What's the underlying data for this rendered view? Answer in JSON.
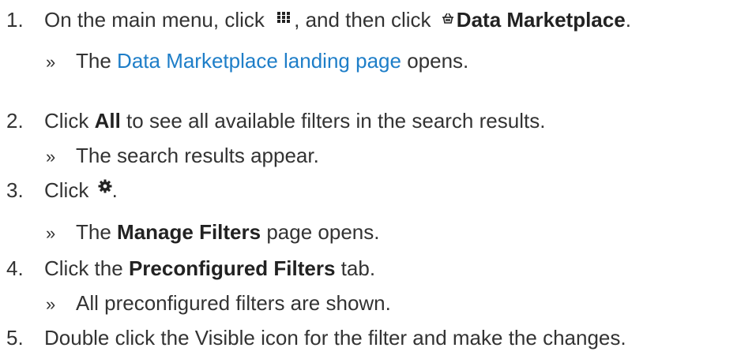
{
  "steps": [
    {
      "number": "1.",
      "text_before": "On the main menu, click",
      "icon1": "app-grid-icon",
      "text_mid": ", and then click",
      "icon2": "basket-icon",
      "bold": "Data Marketplace",
      "text_after": ".",
      "result": {
        "marker": "»",
        "before": "The",
        "link": "Data Marketplace landing page",
        "after": "opens."
      }
    },
    {
      "number": "2.",
      "text_before": "Click",
      "bold": "All",
      "text_after": "to see all available filters in the search results.",
      "result": {
        "marker": "»",
        "text": "The search results appear."
      }
    },
    {
      "number": "3.",
      "text_before": "Click",
      "icon": "gear-icon",
      "text_after": ".",
      "result": {
        "marker": "»",
        "before": "The",
        "bold": "Manage Filters",
        "after": "page opens."
      }
    },
    {
      "number": "4.",
      "text_before": "Click the",
      "bold": "Preconfigured Filters",
      "text_after": "tab.",
      "result": {
        "marker": "»",
        "text": "All preconfigured filters are shown."
      }
    },
    {
      "number": "5.",
      "text": "Double click the Visible icon for the filter and make the changes."
    }
  ],
  "colors": {
    "text": "#333333",
    "link": "#1e7ec8"
  }
}
